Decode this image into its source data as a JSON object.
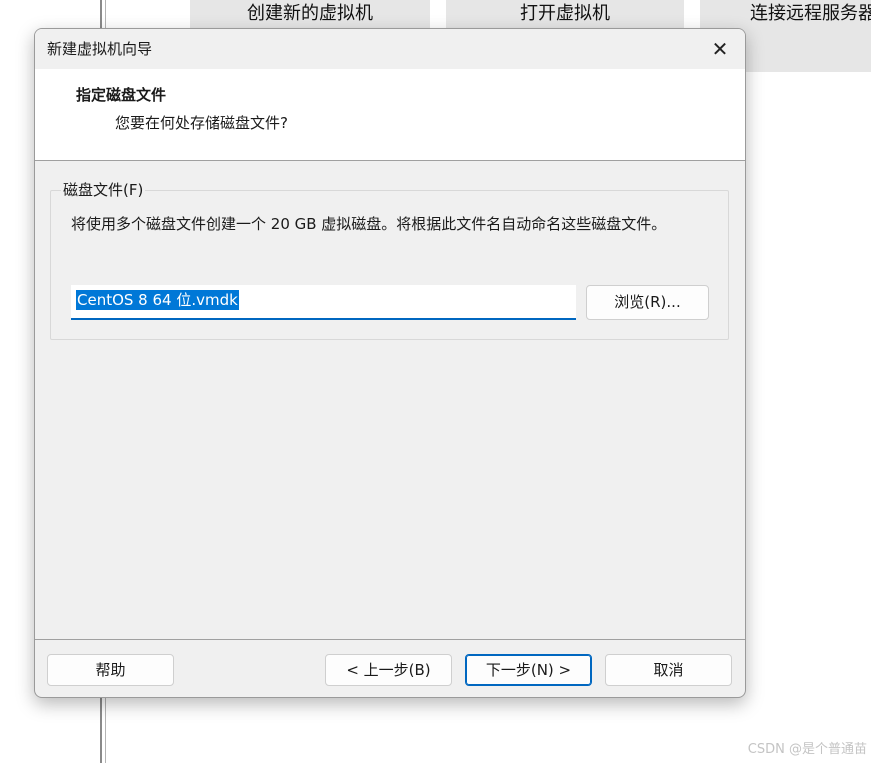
{
  "background": {
    "home_buttons": [
      "创建新的虚拟机",
      "打开虚拟机",
      "连接远程服务器"
    ],
    "watermark": "CSDN @是个普通苗"
  },
  "dialog": {
    "title": "新建虚拟机向导",
    "close_glyph": "✕",
    "header": {
      "title": "指定磁盘文件",
      "subtitle": "您要在何处存储磁盘文件?"
    },
    "group": {
      "legend": "磁盘文件(F)",
      "description": "将使用多个磁盘文件创建一个 20 GB 虚拟磁盘。将根据此文件名自动命名这些磁盘文件。",
      "file_value": "CentOS 8 64 位.vmdk",
      "browse_label": "浏览(R)..."
    },
    "buttons": {
      "help": "帮助",
      "back": "< 上一步(B)",
      "next": "下一步(N) >",
      "cancel": "取消"
    },
    "colors": {
      "accent": "#0067c0",
      "selection": "#0078d7",
      "dialog_bg": "#f0f0f0"
    }
  }
}
